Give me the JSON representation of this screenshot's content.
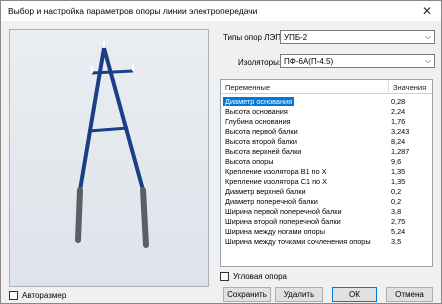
{
  "window": {
    "title": "Выбор и настройка параметров опоры линии электропередачи",
    "close_glyph": "✕"
  },
  "fields": {
    "support_type_label": "Типы опор ЛЭП:",
    "support_type_value": "УПБ-2",
    "insulator_label": "Изоляторы:",
    "insulator_value": "ПФ-6А(П-4.5)",
    "dropdown_glyph": "⌵"
  },
  "table": {
    "col_name": "Переменные",
    "col_value": "Значения",
    "rows": [
      {
        "name": "Диаметр основания",
        "value": "0,28"
      },
      {
        "name": "Высота основания",
        "value": "2,24"
      },
      {
        "name": "Глубина основания",
        "value": "1,76"
      },
      {
        "name": "Высота первой балки",
        "value": "3,243"
      },
      {
        "name": "Высота второй балки",
        "value": "8,24"
      },
      {
        "name": "Высота верхней балки",
        "value": "1,287"
      },
      {
        "name": "Высота опоры",
        "value": "9,6"
      },
      {
        "name": "Крепление изолятора B1 по X",
        "value": "1,35"
      },
      {
        "name": "Крепление изолятора C1 по X",
        "value": "1,35"
      },
      {
        "name": "Диаметр верхней балки",
        "value": "0,2"
      },
      {
        "name": "Диаметр поперечной балки",
        "value": "0,2"
      },
      {
        "name": "Ширина первой поперечной балки",
        "value": "3,8"
      },
      {
        "name": "Ширина второй поперечной балки",
        "value": "2,75"
      },
      {
        "name": "Ширина между ногами опоры",
        "value": "5,24"
      },
      {
        "name": "Ширина между точками сочленения опоры",
        "value": "3,5"
      }
    ],
    "selected_index": 0
  },
  "checkboxes": {
    "corner_label": "Угловая опора",
    "autosize_label": "Авторазмер"
  },
  "buttons": {
    "save": "Сохранить",
    "delete": "Удалить",
    "ok": "ОК",
    "cancel": "Отмена"
  },
  "colors": {
    "selection": "#0078d7",
    "tower": "#1b3f86",
    "base": "#5a5f66"
  }
}
